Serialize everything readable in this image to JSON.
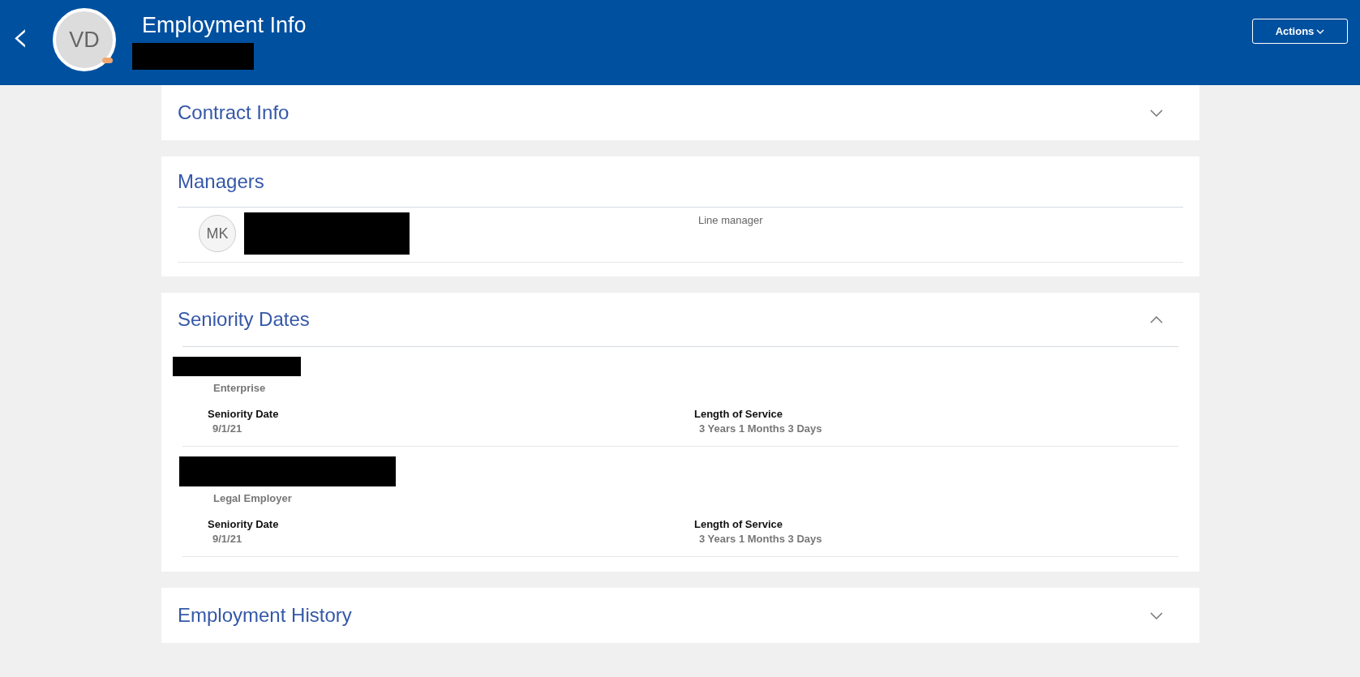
{
  "header": {
    "back_icon": "‹",
    "avatar_initials": "VD",
    "title": "Employment Info",
    "actions_button": "Actions"
  },
  "sections": [
    {
      "title": "Contract Info",
      "kind": "plain",
      "expanded": false
    },
    {
      "title": "Managers",
      "kind": "managers",
      "managers": [
        {
          "initials": "MK",
          "relationship": "Line manager"
        }
      ]
    },
    {
      "title": "Seniority Dates",
      "kind": "seniority",
      "expanded": true,
      "records": [
        {
          "level": "Enterprise",
          "date_label": "Seniority Date",
          "date": "9/1/21",
          "service_label": "Length of Service",
          "service": "3 Years 1 Months 3 Days"
        },
        {
          "level": "Legal Employer",
          "date_label": "Seniority Date",
          "date": "9/1/21",
          "service_label": "Length of Service",
          "service": "3 Years 1 Months 3 Days"
        }
      ]
    },
    {
      "title": "Employment History",
      "kind": "plain",
      "expanded": false
    }
  ]
}
